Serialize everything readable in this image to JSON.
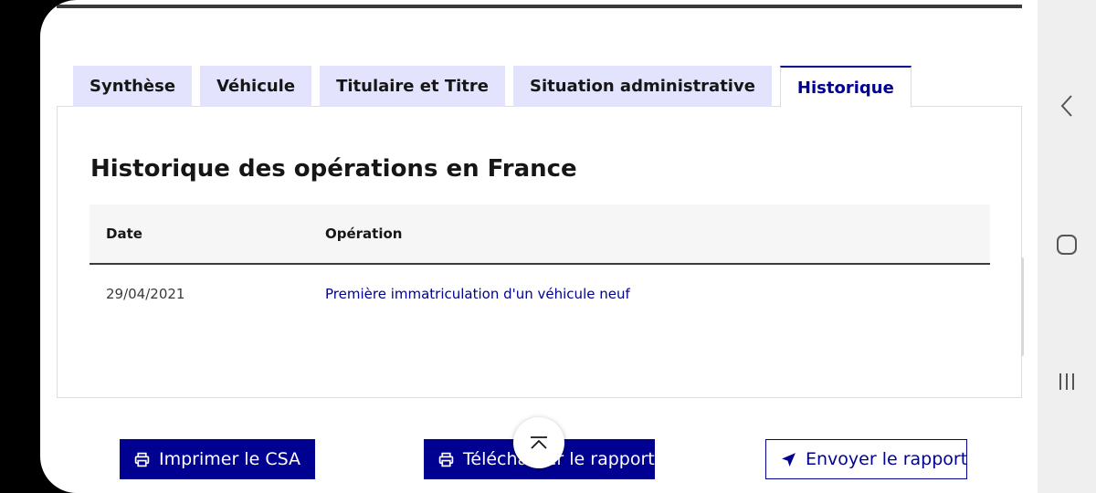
{
  "tabs": [
    {
      "label": "Synthèse"
    },
    {
      "label": "Véhicule"
    },
    {
      "label": "Titulaire et Titre"
    },
    {
      "label": "Situation administrative"
    },
    {
      "label": "Historique"
    }
  ],
  "panel": {
    "title": "Historique des opérations en France",
    "table": {
      "headers": {
        "date": "Date",
        "operation": "Opération"
      },
      "rows": [
        {
          "date": "29/04/2021",
          "operation": "Première immatriculation d'un véhicule neuf"
        }
      ]
    }
  },
  "actions": {
    "print_label": "Imprimer le CSA",
    "download_label": "Télécharger le rapport",
    "send_label": "Envoyer le rapport"
  },
  "icons": {
    "print": "printer-icon",
    "send": "paper-plane-icon",
    "back_to_top": "chevron-up-icon",
    "nav_back": "chevron-left-icon",
    "nav_home": "square-home-icon",
    "nav_recent": "recent-apps-icon"
  },
  "colors": {
    "accent": "#000091",
    "tab_background": "#e3e3fd",
    "header_background": "#f6f6f6"
  }
}
